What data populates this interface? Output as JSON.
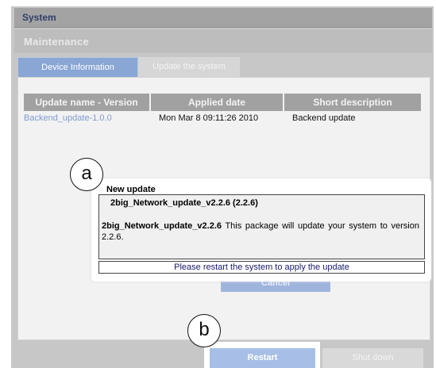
{
  "header": {
    "system_title": "System",
    "section_title": "Maintenance"
  },
  "tabs": [
    {
      "label": "Device Information",
      "active": true
    },
    {
      "label": "Update the system",
      "active": false
    }
  ],
  "table": {
    "columns": [
      "Update name - Version",
      "Applied date",
      "Short description"
    ],
    "rows": [
      {
        "name": "Backend_update-1.0.0",
        "date": "Mon Mar 8 09:11:26 2010",
        "description": "Backend update"
      }
    ]
  },
  "dialog": {
    "title": "New update",
    "package_line": "2big_Network_update_v2.2.6 (2.2.6)",
    "package_name": "2big_Network_update_v2.2.6",
    "description": " This package will update your system to version 2.2.6.",
    "restart_message": "Please restart the system to apply the update"
  },
  "buttons": {
    "cancel": "Cancel",
    "restart": "Restart",
    "shutdown": "Shut down"
  },
  "callouts": {
    "a": "a",
    "b": "b"
  },
  "colors": {
    "accent_blue": "#8aa6d4",
    "header_gray": "#a3a3a3",
    "link_blue": "#7f9bd1"
  }
}
